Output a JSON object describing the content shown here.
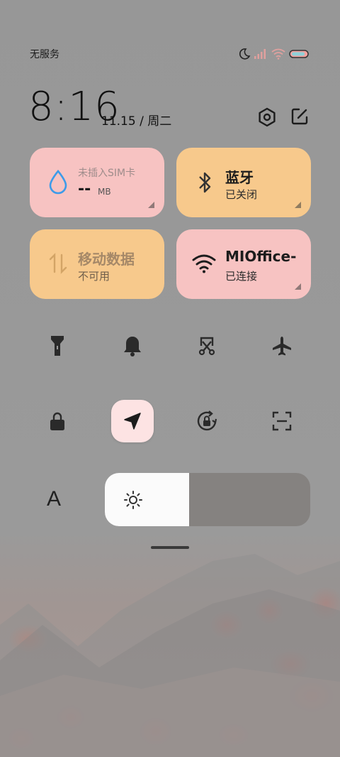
{
  "status_bar": {
    "carrier": "无服务",
    "icons": [
      "moon-icon",
      "signal-icon",
      "wifi-icon",
      "battery-icon"
    ]
  },
  "clock": {
    "time": "8:16",
    "date": "11.15 / 周二"
  },
  "header_icons": [
    "settings-icon",
    "edit-icon"
  ],
  "tiles": {
    "data_usage": {
      "title": "未插入SIM卡",
      "value": "--",
      "unit": "MB",
      "icon": "water-drop-icon",
      "color": "#f7c3c2"
    },
    "bluetooth": {
      "title": "蓝牙",
      "status": "已关闭",
      "icon": "bluetooth-icon",
      "color": "#f7c98c"
    },
    "mobile_data": {
      "title": "移动数据",
      "status": "不可用",
      "icon": "data-arrows-icon",
      "color": "#f7c98c"
    },
    "wifi": {
      "title": "MIOffice-",
      "status": "已连接",
      "icon": "wifi-icon",
      "color": "#f7c3c2"
    }
  },
  "toggles_row1": [
    "flashlight-icon",
    "bell-icon",
    "screenshot-icon",
    "airplane-icon"
  ],
  "toggles_row2": [
    "lock-icon",
    "location-icon",
    "rotation-lock-icon",
    "scan-icon"
  ],
  "active_toggle": "location-icon",
  "font_button_label": "A",
  "brightness": {
    "level": 0.41,
    "icon": "sun-icon"
  }
}
